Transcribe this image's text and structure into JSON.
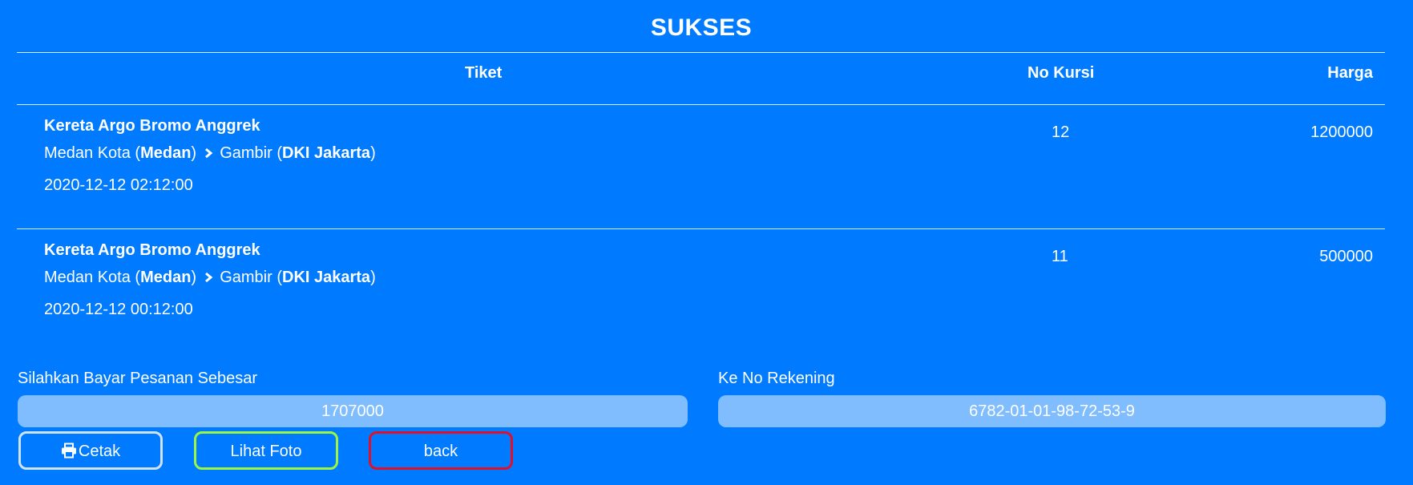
{
  "page": {
    "title": "SUKSES"
  },
  "table": {
    "headers": {
      "ticket": "Tiket",
      "seat": "No Kursi",
      "price": "Harga"
    },
    "rows": [
      {
        "train": "Kereta Argo Bromo Anggrek",
        "from_station": "Medan Kota",
        "from_city": "Medan",
        "to_station": "Gambir",
        "to_city": "DKI Jakarta",
        "datetime": "2020-12-12 02:12:00",
        "seat": "12",
        "price": "1200000"
      },
      {
        "train": "Kereta Argo Bromo Anggrek",
        "from_station": "Medan Kota",
        "from_city": "Medan",
        "to_station": "Gambir",
        "to_city": "DKI Jakarta",
        "datetime": "2020-12-12 00:12:00",
        "seat": "11",
        "price": "500000"
      }
    ]
  },
  "payment": {
    "amount_label": "Silahkan Bayar Pesanan Sebesar",
    "amount_value": "1707000",
    "account_label": "Ke No Rekening",
    "account_value": "6782-01-01-98-72-53-9"
  },
  "buttons": {
    "print_label": "Cetak",
    "print_icon": "printer-icon",
    "photo_label": "Lihat Foto",
    "back_label": "back",
    "print_border_color": "#cfe3f7",
    "photo_border_color": "#9cf542",
    "back_border_color": "#e0102a"
  },
  "colors": {
    "background": "#007bff",
    "field_background": "#80bdff",
    "text": "#ffffff"
  }
}
